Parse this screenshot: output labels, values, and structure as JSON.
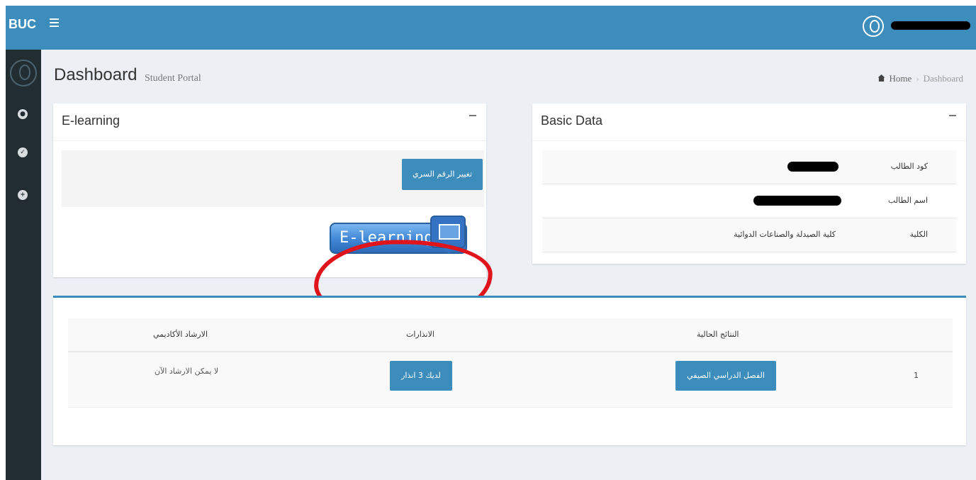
{
  "brand": "BUC",
  "header": {
    "title": "Dashboard",
    "subtitle": "Student Portal"
  },
  "breadcrumb": {
    "home": "Home",
    "current": "Dashboard"
  },
  "elearning_box": {
    "title": "E-learning",
    "change_button": "تغيير الرقم السري",
    "elearning_button": "E-learning"
  },
  "basic_data_box": {
    "title": "Basic Data",
    "rows": [
      {
        "label": "كود الطالب",
        "value": ""
      },
      {
        "label": "اسم الطالب",
        "value": ""
      },
      {
        "label": "الكلية",
        "value": "كلية الصيدلة والصناعات الدوائية"
      }
    ]
  },
  "advising_table": {
    "headers": {
      "results": "النتائج الحالية",
      "warnings": "الانذارات",
      "advising": "الارشاد الأكاديمي"
    },
    "row": {
      "index": "1",
      "results_button": "الفصل الدراسي الصيفي",
      "warnings_button": "لديك 3 انذار",
      "advising_text": "لا يمكن الارشاد الآن"
    }
  },
  "colors": {
    "topbar": "#3c8dbc",
    "sidebar": "#222d32",
    "content_bg": "#ecf0f5",
    "button": "#3c8dbc",
    "annotation": "#e0141b"
  }
}
